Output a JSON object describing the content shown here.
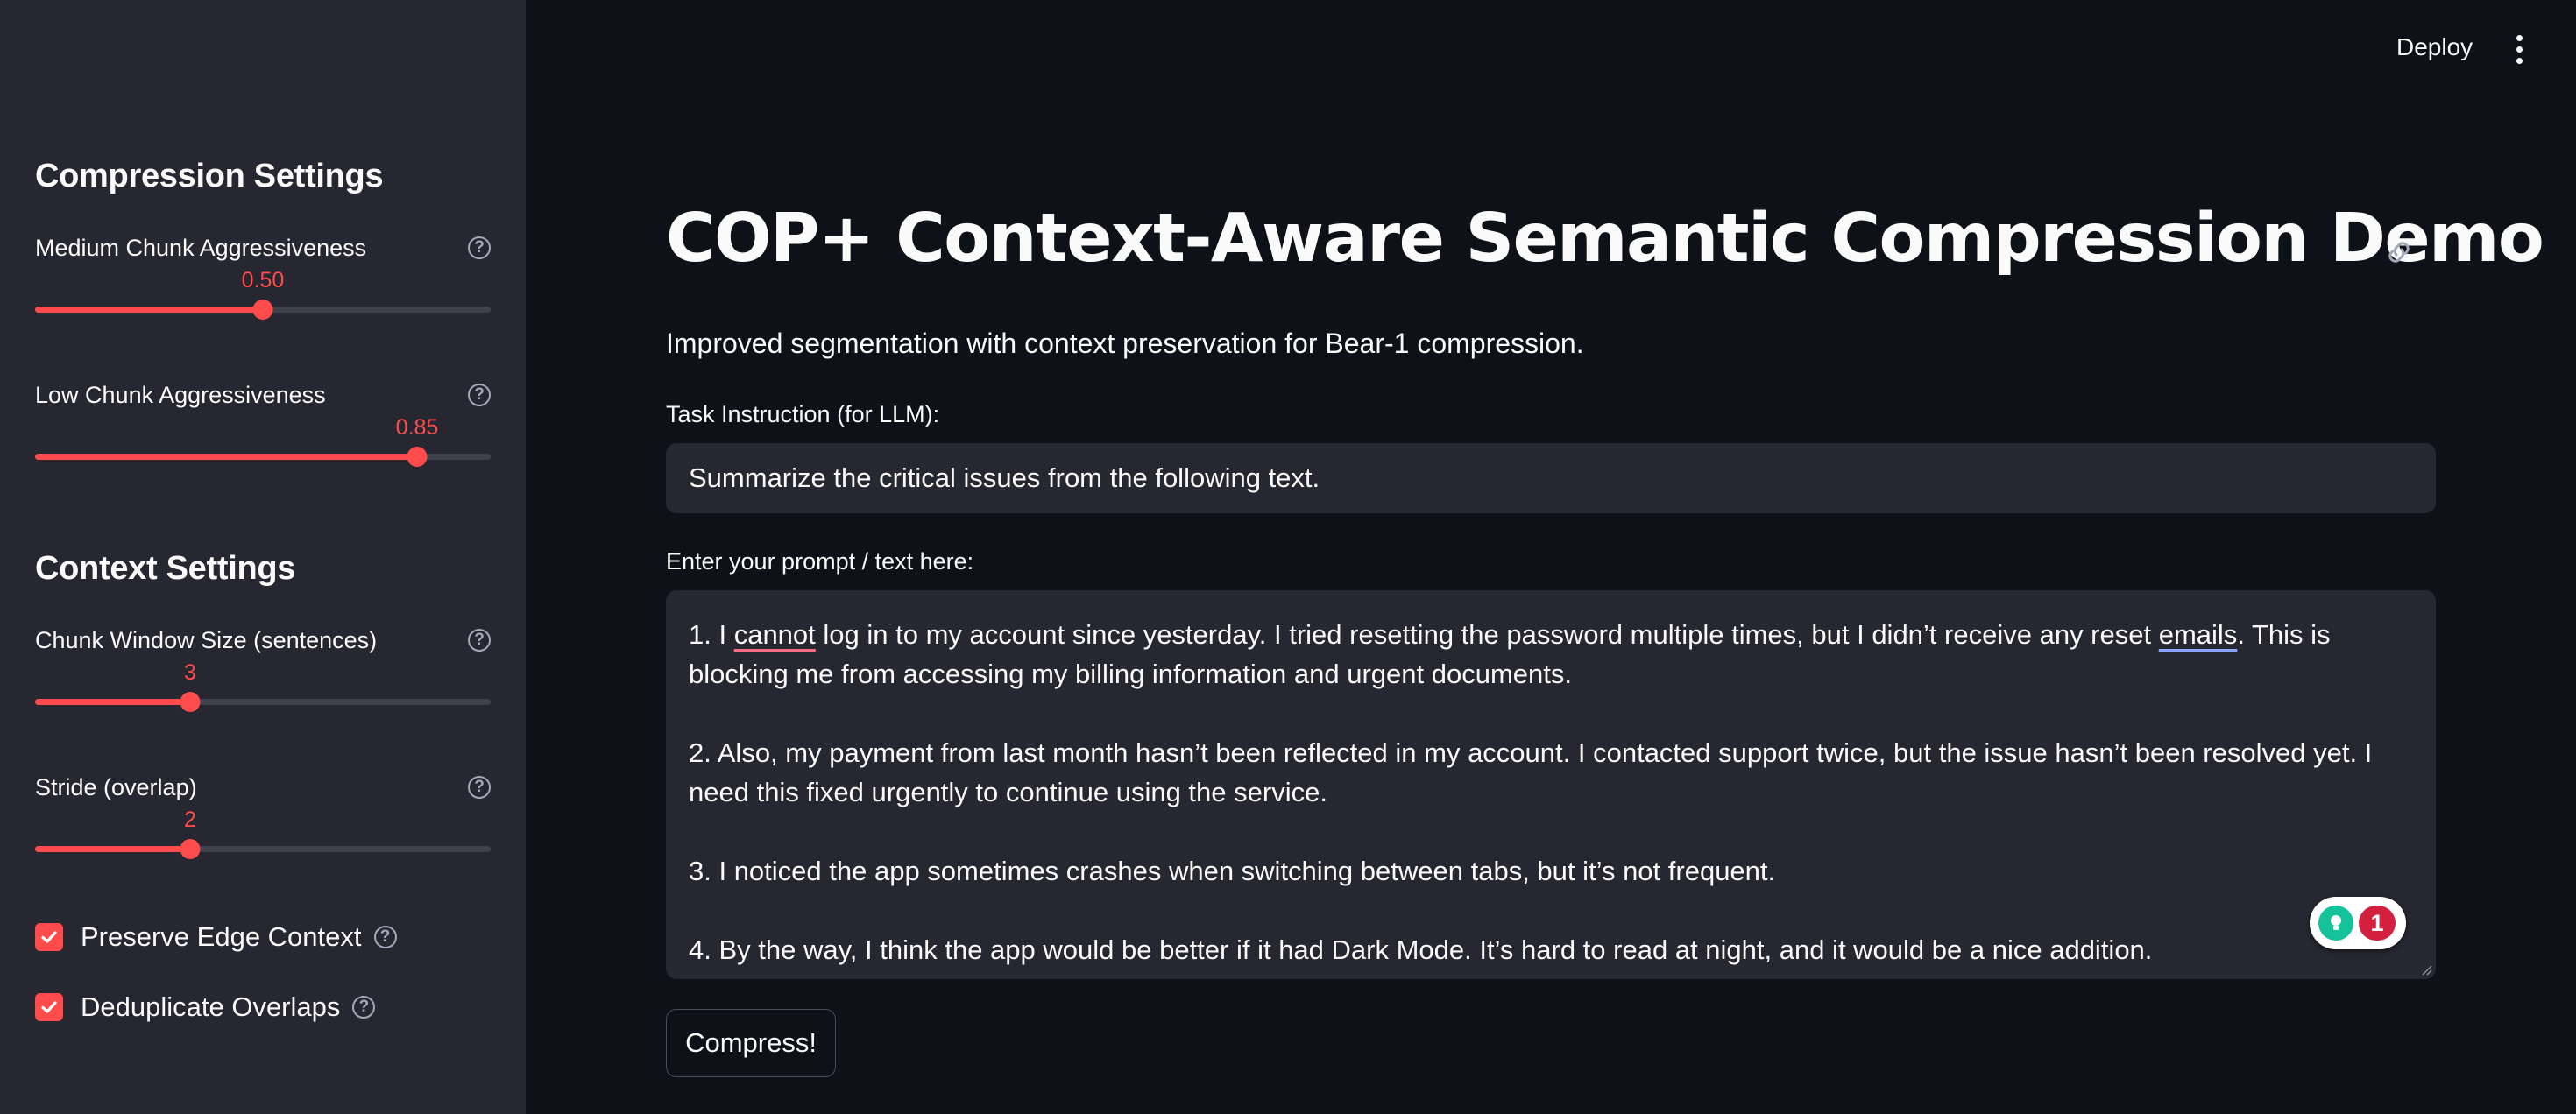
{
  "header": {
    "deploy_label": "Deploy",
    "menu_icon": "kebab-menu-icon"
  },
  "sidebar": {
    "compression_heading": "Compression Settings",
    "context_heading": "Context Settings",
    "sliders": [
      {
        "label": "Medium Chunk Aggressiveness",
        "value_text": "0.50",
        "min": 0,
        "max": 1,
        "value": 0.5
      },
      {
        "label": "Low Chunk Aggressiveness",
        "value_text": "0.85",
        "min": 0,
        "max": 1,
        "value": 0.85
      },
      {
        "label": "Chunk Window Size (sentences)",
        "value_text": "3",
        "value_fraction": 0.34
      },
      {
        "label": "Stride (overlap)",
        "value_text": "2",
        "value_fraction": 0.34
      }
    ],
    "checkboxes": [
      {
        "label": "Preserve Edge Context",
        "checked": true
      },
      {
        "label": "Deduplicate Overlaps",
        "checked": true
      }
    ],
    "help_glyph": "?"
  },
  "main": {
    "title": "COP+ Context-Aware Semantic Compression Demo",
    "subtitle": "Improved segmentation with context preservation for Bear-1 compression.",
    "task_label": "Task Instruction (for LLM):",
    "task_value": "Summarize the critical issues from the following text.",
    "prompt_label": "Enter your prompt / text here:",
    "prompt_paragraphs": {
      "p1_a": "1. I ",
      "p1_word_cannot": "cannot",
      "p1_b": " log in to my account since yesterday. I tried resetting the password multiple times, but I didn’t receive any reset ",
      "p1_word_emails": "emails",
      "p1_c": ". This is blocking me from accessing my billing information and urgent documents.",
      "p2": "2. Also, my payment from last month hasn’t been reflected in my account. I contacted support twice, but the issue hasn’t been resolved yet. I need this fixed urgently to continue using the service.",
      "p3": "3. I noticed the app sometimes crashes when switching between tabs, but it’s not frequent.",
      "p4": "4. By the way, I think the app would be better if it had Dark Mode. It’s hard to read at night, and it would be a nice addition."
    },
    "grammar_badge_count": "1",
    "compress_label": "Compress!"
  }
}
